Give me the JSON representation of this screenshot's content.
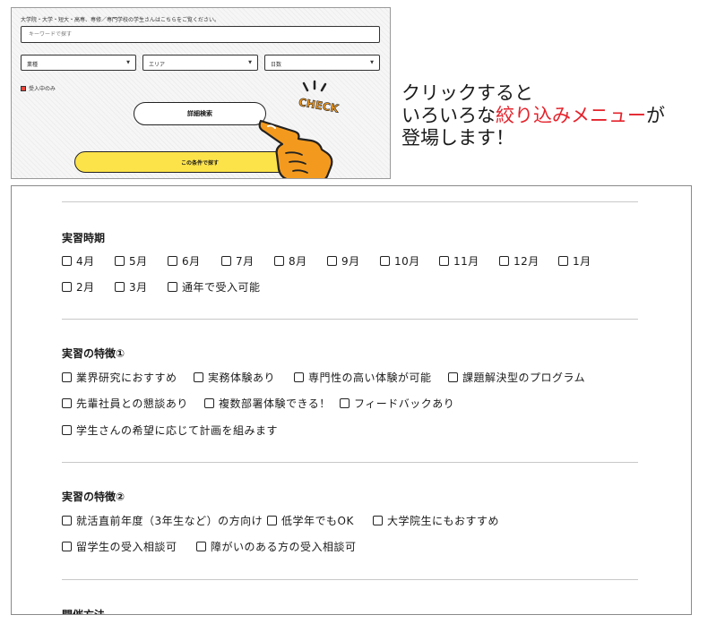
{
  "screenshot": {
    "note": "大学院・大学・短大・高専、専修／専門学校の学生さんはこちらをご覧ください。",
    "keyword_placeholder": "キーワードで探す",
    "selects": [
      "業種",
      "エリア",
      "日数"
    ],
    "checkbox_label": "受入中のみ",
    "detail_button": "詳細検索",
    "search_button": "この条件で探す",
    "badge": "CHECK",
    "colors": {
      "button_yellow": "#fde34a",
      "hand_orange": "#f39a1e"
    }
  },
  "caption": {
    "line1": "クリックすると",
    "line2_prefix": "いろいろな",
    "line2_accent": "絞り込みメニュー",
    "line2_suffix": "が",
    "line3": "登場します！",
    "accent_color": "#e4222b"
  },
  "sections": [
    {
      "title": "実習時期",
      "rows": [
        [
          "4月",
          "5月",
          "6月",
          "7月",
          "8月",
          "9月",
          "10月",
          "11月",
          "12月",
          "1月"
        ],
        [
          "2月",
          "3月",
          "通年で受入可能"
        ]
      ]
    },
    {
      "title": "実習の特徴①",
      "rows": [
        [
          "業界研究におすすめ",
          "実務体験あり",
          "専門性の高い体験が可能",
          "課題解決型のプログラム"
        ],
        [
          "先輩社員との懇談あり",
          "複数部署体験できる！",
          "フィードバックあり"
        ],
        [
          "学生さんの希望に応じて計画を組みます"
        ]
      ]
    },
    {
      "title": "実習の特徴②",
      "rows": [
        [
          "就活直前年度（3年生など）の方向け",
          "低学年でもOK",
          "大学院生にもおすすめ"
        ],
        [
          "留学生の受入相談可",
          "障がいのある方の受入相談可"
        ]
      ]
    },
    {
      "title": "開催方法",
      "rows": []
    }
  ]
}
